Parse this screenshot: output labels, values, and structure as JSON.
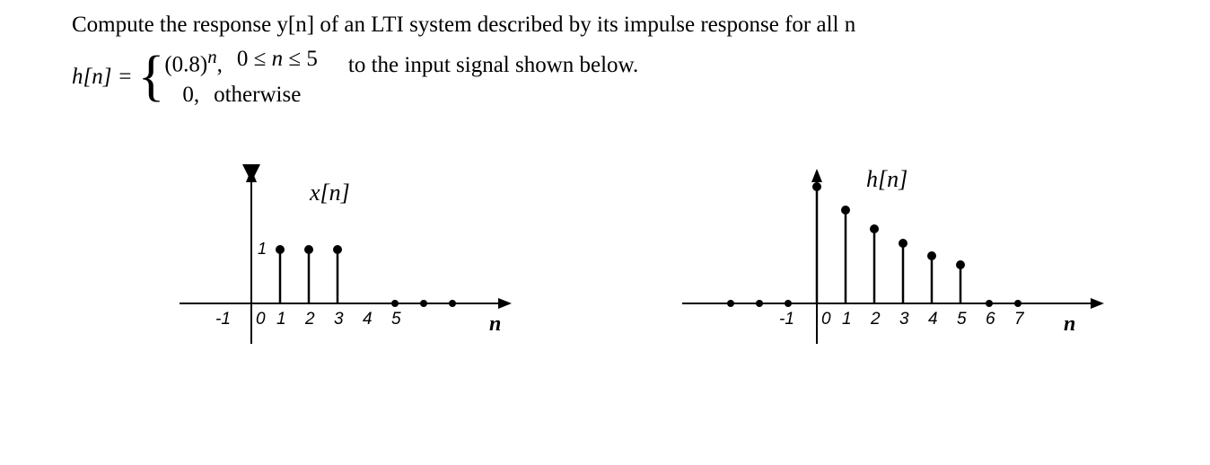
{
  "text": {
    "line1": "Compute the response y[n] of an LTI system described by its impulse response for all n",
    "hn_label": "h[n] = ",
    "case1_value": "(0.8)",
    "case1_exp": "n",
    "case1_comma": ",",
    "case1_cond": "0 ≤ n ≤ 5",
    "case2_value": "0,",
    "case2_cond": "otherwise",
    "input_text": "to the input signal shown below."
  },
  "plot_x": {
    "title": "x[n]",
    "axis_label": "n",
    "y_tick": "1",
    "x_ticks": [
      "-1",
      "0",
      "1",
      "2",
      "3",
      "4",
      "5"
    ]
  },
  "plot_h": {
    "title": "h[n]",
    "axis_label": "n",
    "x_ticks": [
      "-1",
      "0",
      "1",
      "2",
      "3",
      "4",
      "5",
      "6",
      "7"
    ]
  },
  "chart_data": [
    {
      "type": "stem",
      "title": "x[n]",
      "xlabel": "n",
      "ylabel": "",
      "x": [
        -1,
        0,
        1,
        2,
        3,
        4,
        5,
        6
      ],
      "values": [
        0,
        0,
        1,
        1,
        1,
        0,
        0,
        0
      ],
      "ylim": [
        0,
        1.2
      ],
      "xlim": [
        -2,
        7
      ]
    },
    {
      "type": "stem",
      "title": "h[n]",
      "xlabel": "n",
      "ylabel": "",
      "x": [
        -3,
        -2,
        -1,
        0,
        1,
        2,
        3,
        4,
        5,
        6,
        7
      ],
      "values": [
        0,
        0,
        0,
        1.0,
        0.8,
        0.64,
        0.512,
        0.41,
        0.328,
        0,
        0
      ],
      "ylim": [
        0,
        1.2
      ],
      "xlim": [
        -4,
        9
      ]
    }
  ]
}
